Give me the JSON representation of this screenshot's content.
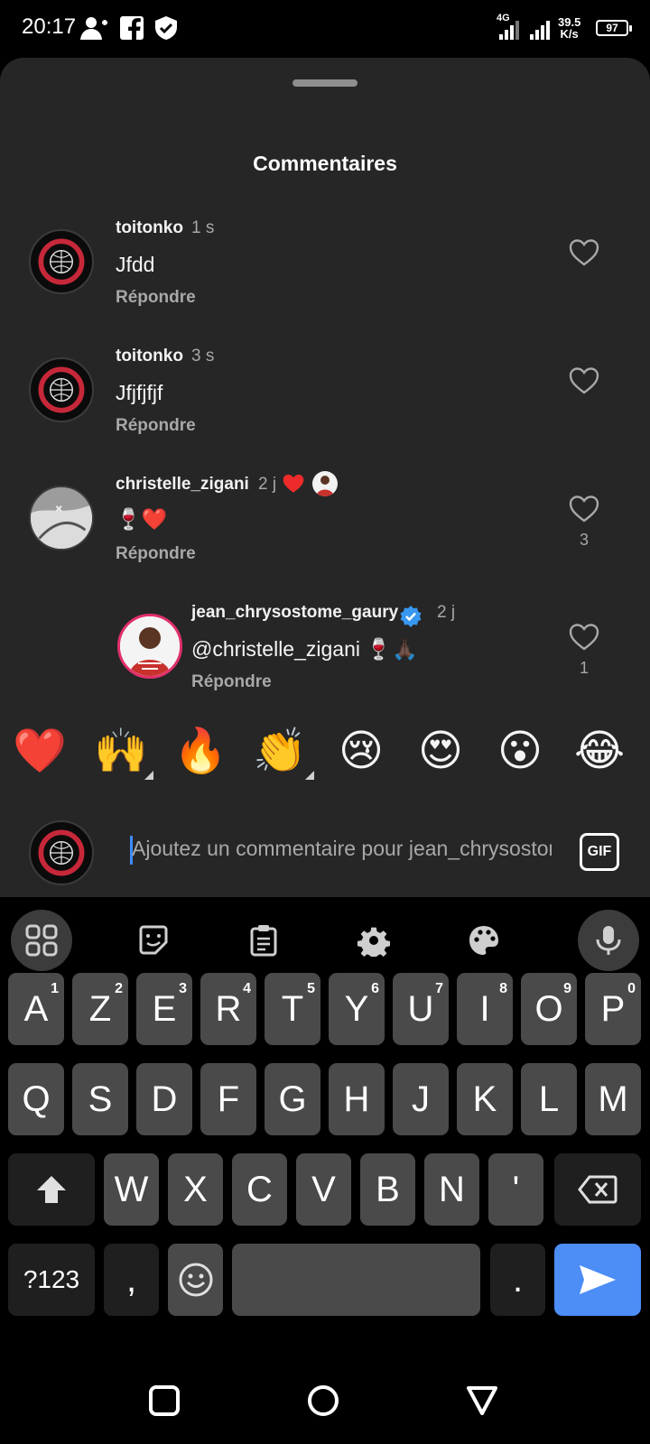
{
  "status": {
    "time": "20:17",
    "network": "4G",
    "speed_value": "39.5",
    "speed_unit": "K/s",
    "battery": "97",
    "icons": [
      "add-person-icon",
      "facebook-icon",
      "shield-icon",
      "signal-icon",
      "signal-icon"
    ]
  },
  "sheet": {
    "title": "Commentaires"
  },
  "comments": [
    {
      "username": "toitonko",
      "time": "1 s",
      "text": "Jfdd",
      "reply": "Répondre",
      "likes": ""
    },
    {
      "username": "toitonko",
      "time": "3 s",
      "text": "Jfjfjfjf",
      "reply": "Répondre",
      "likes": ""
    },
    {
      "username": "christelle_zigani",
      "time": "2 j",
      "text": "🍷❤️",
      "reply": "Répondre",
      "likes": "3"
    },
    {
      "username": "jean_chrysostome_gaury",
      "time": "2 j",
      "text": "@christelle_zigani 🍷🙏🏿",
      "reply": "Répondre",
      "likes": "1",
      "verified": true
    }
  ],
  "emoji_bar": [
    "❤️",
    "🙌",
    "🔥",
    "👏",
    "😢",
    "😍",
    "😮",
    "😂"
  ],
  "composer": {
    "placeholder": "Ajoutez un commentaire pour jean_chrysostome_gaury...",
    "gif_label": "GIF"
  },
  "keyboard": {
    "toolbar": [
      "apps-icon",
      "sticker-icon",
      "clipboard-icon",
      "settings-icon",
      "palette-icon",
      "microphone-icon"
    ],
    "row1": [
      {
        "key": "A",
        "hint": "1"
      },
      {
        "key": "Z",
        "hint": "2"
      },
      {
        "key": "E",
        "hint": "3"
      },
      {
        "key": "R",
        "hint": "4"
      },
      {
        "key": "T",
        "hint": "5"
      },
      {
        "key": "Y",
        "hint": "6"
      },
      {
        "key": "U",
        "hint": "7"
      },
      {
        "key": "I",
        "hint": "8"
      },
      {
        "key": "O",
        "hint": "9"
      },
      {
        "key": "P",
        "hint": "0"
      }
    ],
    "row2": [
      "Q",
      "S",
      "D",
      "F",
      "G",
      "H",
      "J",
      "K",
      "L",
      "M"
    ],
    "row3": [
      "W",
      "X",
      "C",
      "V",
      "B",
      "N",
      "'"
    ],
    "row4": {
      "symbols": "?123",
      "comma": ",",
      "period": "."
    }
  },
  "colors": {
    "sheet_bg": "#262626",
    "accent": "#4c8df6",
    "like_red": "#ed2b2b",
    "verified": "#3897f0"
  }
}
